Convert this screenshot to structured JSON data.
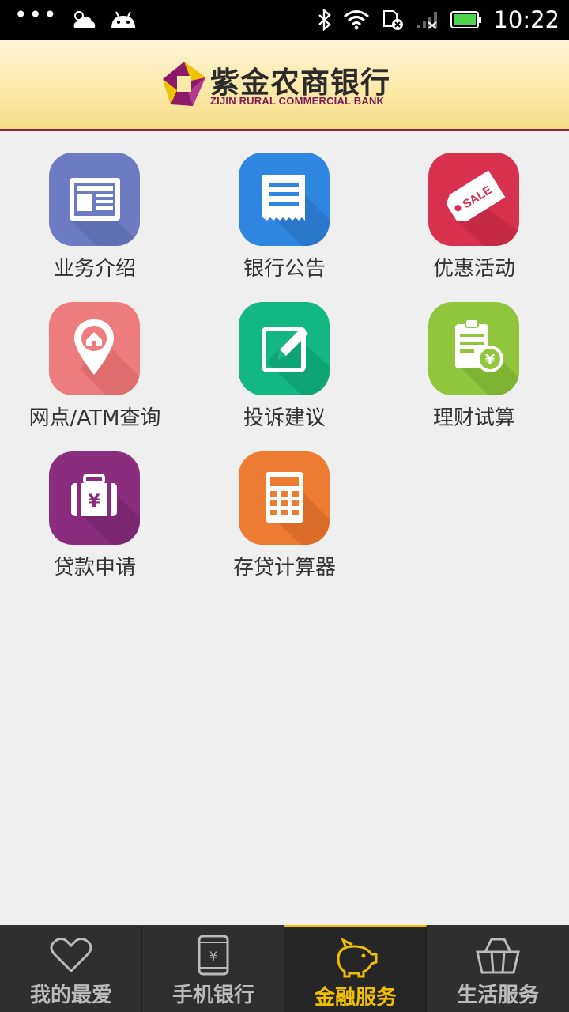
{
  "status_bar": {
    "dots": "•••",
    "time": "10:22",
    "icons": [
      "weather-icon",
      "android-icon",
      "bluetooth-icon",
      "wifi-icon",
      "sim-icon",
      "signal-icon",
      "battery-icon"
    ]
  },
  "header": {
    "logo_cn": "紫金农商银行",
    "logo_en": "ZIJIN RURAL COMMERCIAL BANK"
  },
  "services": [
    {
      "label": "业务介绍",
      "icon": "newspaper-icon",
      "color": "#6c7bc2"
    },
    {
      "label": "银行公告",
      "icon": "receipt-icon",
      "color": "#2f86e0"
    },
    {
      "label": "优惠活动",
      "icon": "sale-tag-icon",
      "color": "#d8314f"
    },
    {
      "label": "网点/ATM查询",
      "icon": "location-pin-icon",
      "color": "#ef7c7c"
    },
    {
      "label": "投诉建议",
      "icon": "edit-icon",
      "color": "#12b782"
    },
    {
      "label": "理财试算",
      "icon": "clipboard-yen-icon",
      "color": "#8fc63c"
    },
    {
      "label": "贷款申请",
      "icon": "briefcase-yen-icon",
      "color": "#8b2d7e"
    },
    {
      "label": "存贷计算器",
      "icon": "calculator-icon",
      "color": "#ee7b32"
    }
  ],
  "bottom_nav": {
    "items": [
      {
        "label": "我的最爱",
        "icon": "heart-icon"
      },
      {
        "label": "手机银行",
        "icon": "phone-yen-icon"
      },
      {
        "label": "金融服务",
        "icon": "piggy-bank-icon",
        "active": true
      },
      {
        "label": "生活服务",
        "icon": "basket-icon"
      }
    ],
    "active_color": "#f0c000"
  }
}
